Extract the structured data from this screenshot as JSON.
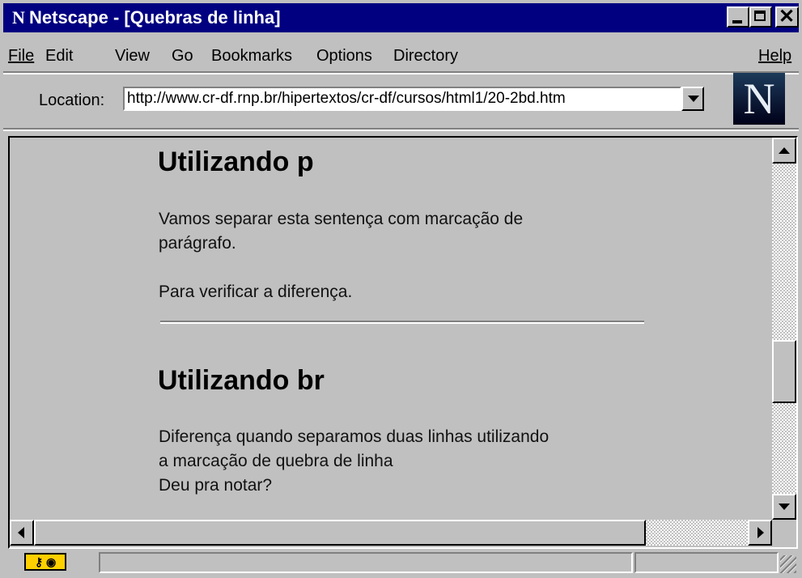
{
  "window": {
    "title": "Netscape - [Quebras de linha]",
    "app_icon": "N",
    "controls": {
      "close_glyph": "✕"
    }
  },
  "menu": {
    "items": [
      "File",
      "Edit",
      "View",
      "Go",
      "Bookmarks",
      "Options",
      "Directory"
    ],
    "help": "Help"
  },
  "location": {
    "label": "Location:",
    "url": "http://www.cr-df.rnp.br/hipertextos/cr-df/cursos/html1/20-2bd.htm"
  },
  "logo": {
    "letter": "N"
  },
  "content": {
    "heading1": "Utilizando p",
    "p1_line1": "Vamos separar esta sentença com marcação de",
    "p1_line2": "parágrafo.",
    "p2": "Para verificar a diferença.",
    "heading2": "Utilizando br",
    "br_line1": "Diferença quando separamos duas linhas utilizando",
    "br_line2": "a marcação de quebra de linha",
    "br_line3": "Deu pra notar?"
  },
  "status": {
    "security_icon": "key-icon",
    "message": ""
  },
  "colors": {
    "titlebar": "#000080",
    "chrome": "#c0c0c0",
    "text": "#000000"
  }
}
